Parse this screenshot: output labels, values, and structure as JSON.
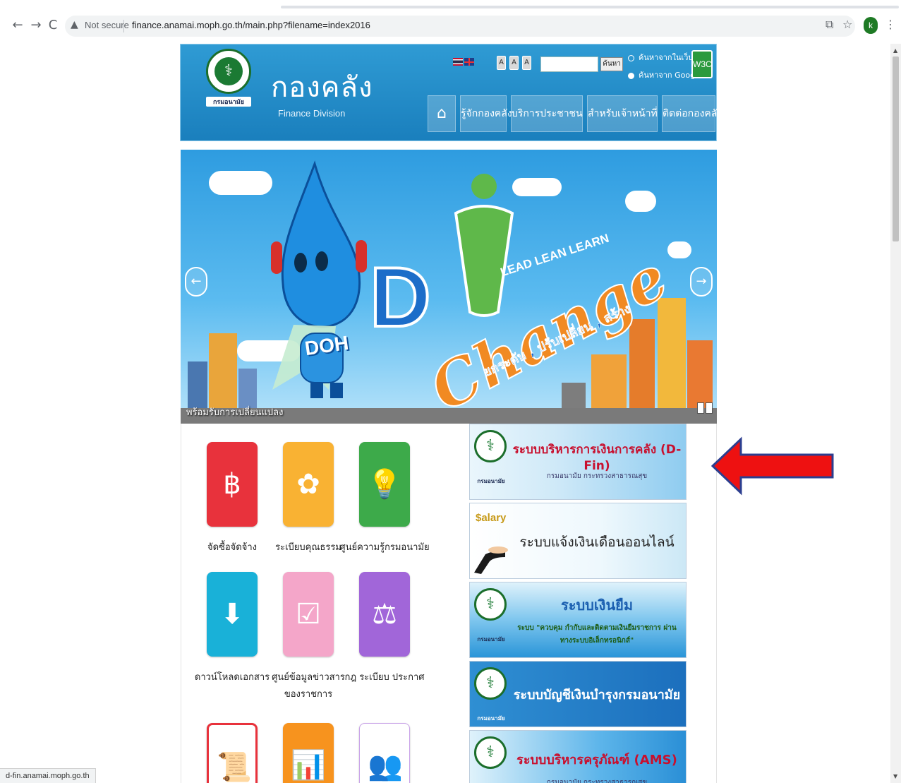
{
  "browser": {
    "security_label": "Not secure",
    "url": "finance.anamai.moph.go.th/main.php?filename=index2016",
    "profile_initial": "k",
    "status_url": "d-fin.anamai.moph.go.th"
  },
  "header": {
    "title": "กองคลัง",
    "subtitle": "Finance Division",
    "seal_label": "กรมอนามัย",
    "font_sizes": [
      "A",
      "A",
      "A"
    ],
    "search_button": "ค้นหา",
    "search_value": "",
    "radio_options": [
      {
        "label": "ค้นหาจากในเว็บ",
        "checked": false
      },
      {
        "label": "ค้นหาจาก Google",
        "checked": true
      }
    ],
    "w3c_label": "W3C",
    "menu": [
      "รู้จักกองคลัง",
      "บริการประชาชน",
      "สำหรับเจ้าหน้าที่",
      "ติดต่อกองคลัง"
    ]
  },
  "banner": {
    "caption": "พร้อมรับการเปลี่ยนแปลง",
    "mascot_label": "DOH",
    "slogan_top": "LEAD LEAN LEARN",
    "slogan_main": "Change",
    "slogan_thai": "ยกระดับ , ปรับเปลี่ยน , สร้าง"
  },
  "tiles": [
    {
      "label": "จัดซื้อจัดจ้าง",
      "color": "#e8323c",
      "icon": "baht-hand-icon"
    },
    {
      "label": "ระเบียบคุณธรรม",
      "color": "#f9b233",
      "icon": "lotus-icon"
    },
    {
      "label": "ศูนย์ความรู้กรมอนามัย",
      "color": "#3daa4a",
      "icon": "lightbulb-icon"
    },
    {
      "label": "ดาวน์โหลดเอกสาร",
      "color": "#19b1d8",
      "icon": "download-folder-icon"
    },
    {
      "label": "ศูนย์ข้อมูลข่าวสาร ของราชการ",
      "color": "#f4a6c9",
      "icon": "document-check-icon"
    },
    {
      "label": "กฎ ระเบียบ ประกาศ",
      "color": "#a166d9",
      "icon": "scales-icon"
    },
    {
      "label": "",
      "color": "#e8323c",
      "icon": "certificate-icon"
    },
    {
      "label": "",
      "color": "#f7931e",
      "icon": "chart-board-icon"
    },
    {
      "label": "",
      "color": "#ffffff",
      "icon": "people-group-icon"
    }
  ],
  "systems": [
    {
      "title": "ระบบบริหารการเงินการคลัง (D-Fin)",
      "sub": "กรมอนามัย กระทรวงสาธารณสุข"
    },
    {
      "title": "ระบบแจ้งเงินเดือนออนไลน์",
      "sub": "",
      "badge": "$alary"
    },
    {
      "title": "ระบบเงินยืม",
      "sub": "ระบบ \"ควบคุม กำกับและติดตามเงินยืมราชการ ผ่านทางระบบอิเล็กทรอนิกส์\""
    },
    {
      "title": "ระบบบัญชีเงินบำรุงกรมอนามัย",
      "sub": ""
    },
    {
      "title": "ระบบบริหารครุภัณฑ์ (AMS)",
      "sub": "กรมอนามัย กระทรวงสาธารณสุข"
    }
  ]
}
